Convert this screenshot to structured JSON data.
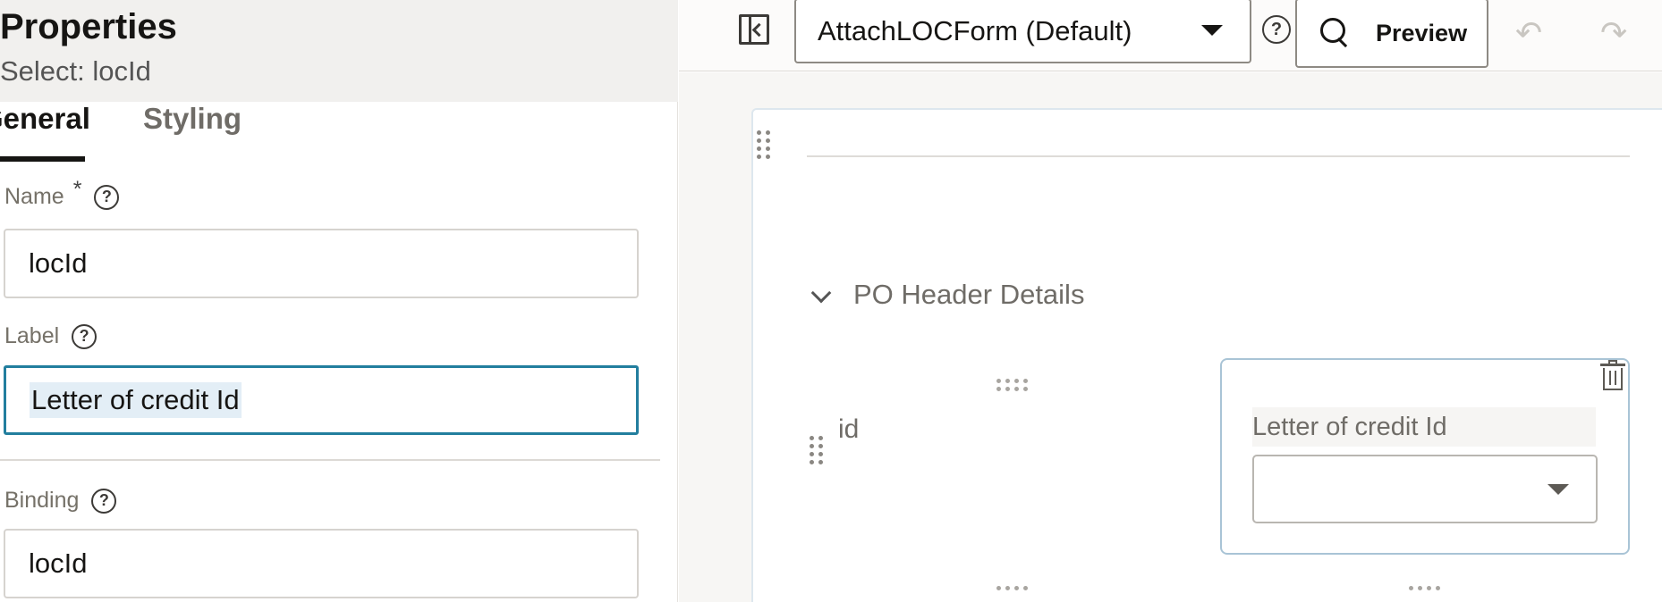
{
  "properties": {
    "title": "Properties",
    "subtitle": "Select: locId",
    "tabs": [
      {
        "label": "General",
        "active": true
      },
      {
        "label": "Styling",
        "active": false
      }
    ],
    "fields": {
      "name": {
        "label": "Name",
        "required_mark": "*",
        "value": "locId"
      },
      "label": {
        "label": "Label",
        "value": "Letter of credit Id"
      },
      "binding": {
        "label": "Binding",
        "value": "locId"
      }
    },
    "help_glyph": "?"
  },
  "toolbar": {
    "form_select_value": "AttachLOCForm (Default)",
    "help_glyph": "?",
    "preview_label": "Preview",
    "undo_glyph": "↶",
    "redo_glyph": "↷"
  },
  "canvas": {
    "section_title": "PO Header Details",
    "id_field_label": "id",
    "loc_field_label": "Letter of credit Id",
    "loc_field_value": ""
  },
  "colors": {
    "accent": "#227e9e",
    "header_bg": "#f1f0ee",
    "canvas_bg": "#f7f6f4"
  }
}
